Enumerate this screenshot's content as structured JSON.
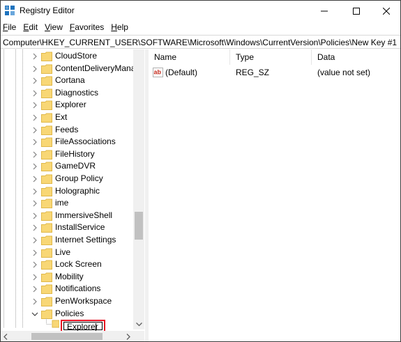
{
  "window": {
    "title": "Registry Editor"
  },
  "menu": [
    {
      "label": "File"
    },
    {
      "label": "Edit"
    },
    {
      "label": "View"
    },
    {
      "label": "Favorites"
    },
    {
      "label": "Help"
    }
  ],
  "address": "Computer\\HKEY_CURRENT_USER\\SOFTWARE\\Microsoft\\Windows\\CurrentVersion\\Policies\\New Key #1",
  "tree": {
    "items": [
      {
        "label": "CloudStore"
      },
      {
        "label": "ContentDeliveryMana"
      },
      {
        "label": "Cortana"
      },
      {
        "label": "Diagnostics"
      },
      {
        "label": "Explorer"
      },
      {
        "label": "Ext"
      },
      {
        "label": "Feeds"
      },
      {
        "label": "FileAssociations"
      },
      {
        "label": "FileHistory"
      },
      {
        "label": "GameDVR"
      },
      {
        "label": "Group Policy"
      },
      {
        "label": "Holographic"
      },
      {
        "label": "ime"
      },
      {
        "label": "ImmersiveShell"
      },
      {
        "label": "InstallService"
      },
      {
        "label": "Internet Settings"
      },
      {
        "label": "Live"
      },
      {
        "label": "Lock Screen"
      },
      {
        "label": "Mobility"
      },
      {
        "label": "Notifications"
      },
      {
        "label": "PenWorkspace"
      },
      {
        "label": "Policies"
      }
    ],
    "rename_value": "Explorer"
  },
  "list": {
    "columns": {
      "name": "Name",
      "type": "Type",
      "data": "Data"
    },
    "rows": [
      {
        "name": "(Default)",
        "type": "REG_SZ",
        "data": "(value not set)"
      }
    ]
  },
  "colors": {
    "rename_border": "#e81123",
    "folder": "#f8d775",
    "folder_dark": "#e0b84a"
  }
}
